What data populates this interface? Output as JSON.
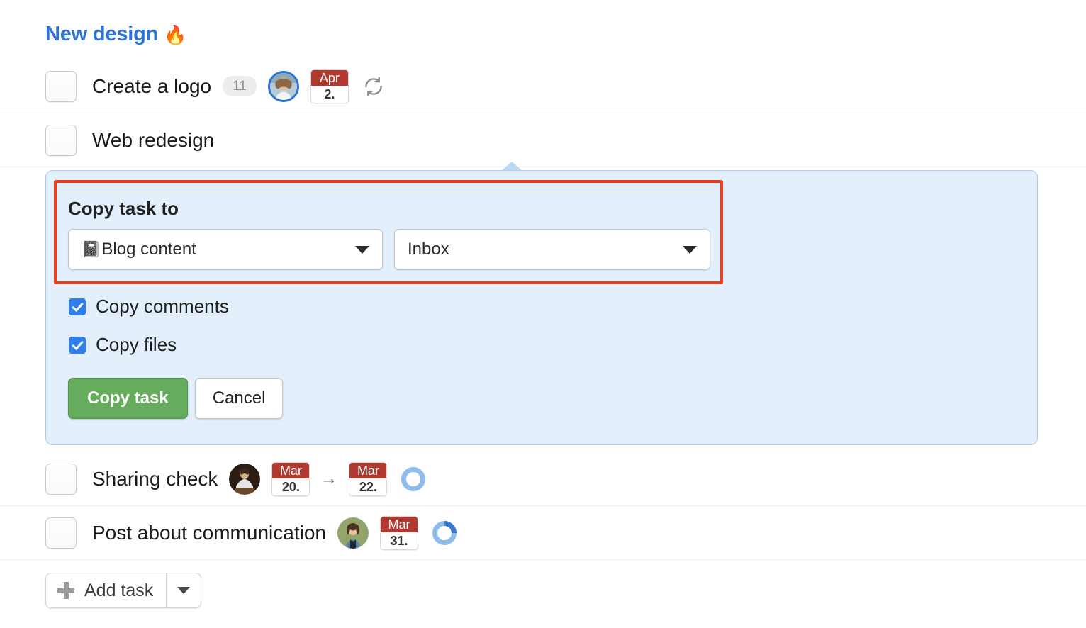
{
  "project": {
    "title": "New design",
    "emoji": "🔥"
  },
  "tasks": [
    {
      "name": "Create a logo",
      "comment_count": "11",
      "date_month": "Apr",
      "date_day": "2.",
      "repeat_icon": "repeat-icon",
      "has_avatar": true
    },
    {
      "name": "Web redesign"
    },
    {
      "name": "Sharing check",
      "date_month": "Mar",
      "date_day": "20.",
      "arrow": "→",
      "date2_month": "Mar",
      "date2_day": "22.",
      "progress": 0,
      "has_avatar": true
    },
    {
      "name": "Post about communication",
      "date_month": "Mar",
      "date_day": "31.",
      "progress": 25,
      "has_avatar": true
    }
  ],
  "copy_panel": {
    "title": "Copy task to",
    "project_select": {
      "emoji": "📓",
      "value": "Blog content",
      "caret_icon": "chevron-down-icon"
    },
    "list_select": {
      "value": "Inbox",
      "caret_icon": "chevron-down-icon"
    },
    "options": [
      {
        "label": "Copy comments",
        "checked": true
      },
      {
        "label": "Copy files",
        "checked": true
      }
    ],
    "confirm_label": "Copy task",
    "cancel_label": "Cancel"
  },
  "add_task": {
    "label": "Add task",
    "plus_icon": "plus-icon",
    "caret_icon": "chevron-down-icon"
  },
  "colors": {
    "title_blue": "#2C74D6",
    "panel_bg": "#E3F0FB",
    "panel_border": "#AACCEE",
    "annotation_red": "#E8401F",
    "confirm_green": "#66AC5D",
    "checkbox_blue": "#2D7FF0",
    "date_red": "#B1392F",
    "progress_track": "#8FBDEB",
    "progress_fill": "#3A78D0"
  }
}
